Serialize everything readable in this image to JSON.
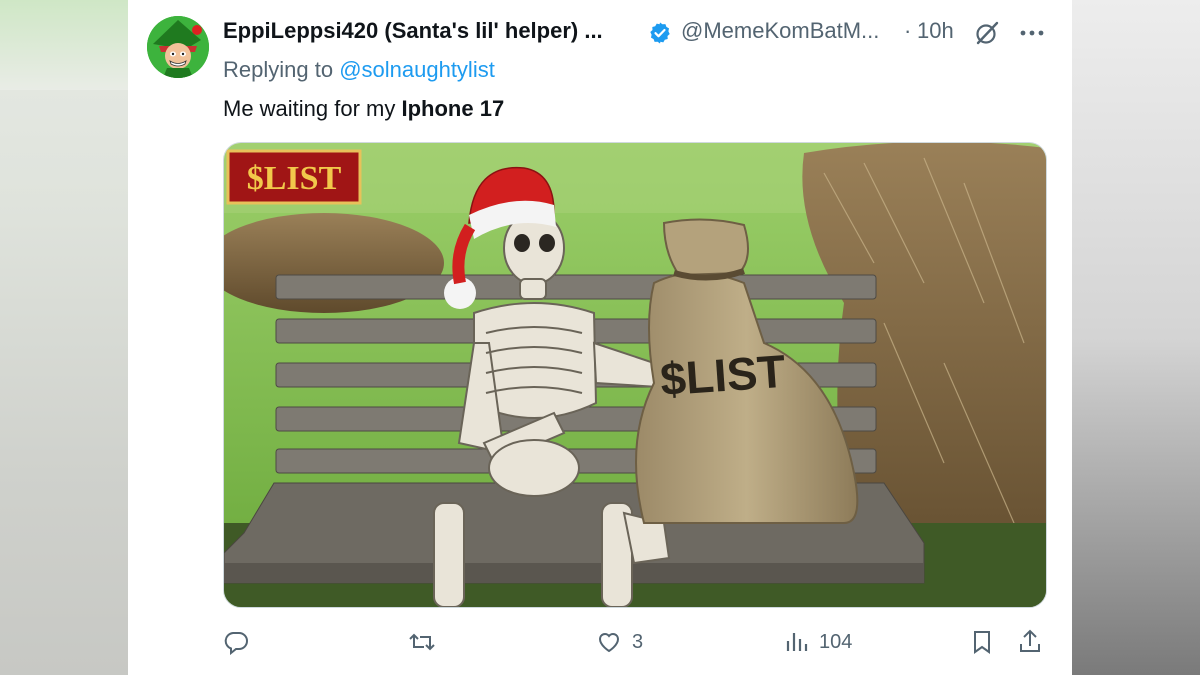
{
  "tweet": {
    "display_name": "EppiLeppsi420 (Santa's lil' helper) ...",
    "verified_icon": "verified-badge-icon",
    "handle": "@MemeKomBatM...",
    "separator": "·",
    "time": "10h",
    "replying_prefix": "Replying to ",
    "replying_to": "@solnaughtylist",
    "text_prefix": "Me waiting for my ",
    "text_bold": "Iphone 17",
    "media": {
      "logo_text": "$LIST",
      "sack_text": "$LIST"
    }
  },
  "actions": {
    "reply": {
      "icon": "reply-icon",
      "count": ""
    },
    "retweet": {
      "icon": "retweet-icon",
      "count": ""
    },
    "like": {
      "icon": "heart-icon",
      "count": "3"
    },
    "views": {
      "icon": "views-chart-icon",
      "count": "104"
    },
    "bookmark": {
      "icon": "bookmark-icon"
    },
    "share": {
      "icon": "share-icon"
    }
  },
  "colors": {
    "link": "#1d9bf0",
    "secondary_text": "#536471",
    "primary_text": "#0f1419",
    "verified": "#1d9bf0"
  }
}
